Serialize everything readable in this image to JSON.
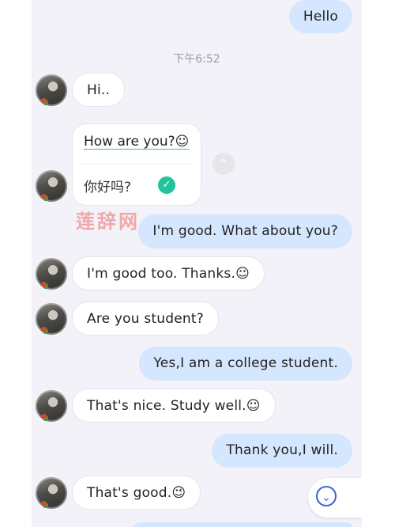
{
  "timestamp": "下午6:52",
  "messages": [
    {
      "side": "out",
      "text": "Hello"
    },
    {
      "side": "in",
      "text": "Hi.."
    },
    {
      "side": "in",
      "card": true,
      "text": "How are you?",
      "emoji": "☺",
      "translation": "你好吗?"
    },
    {
      "side": "out",
      "text": "I'm good. What about you?"
    },
    {
      "side": "in",
      "text": "I'm good too. Thanks.☺"
    },
    {
      "side": "in",
      "text": "Are you student?"
    },
    {
      "side": "out",
      "text": "Yes,I am a college student."
    },
    {
      "side": "in",
      "text": "That's nice. Study well.☺"
    },
    {
      "side": "out",
      "text": "Thank you,I will."
    },
    {
      "side": "in",
      "text": "That's good.😉"
    }
  ],
  "watermark": "莲辞网",
  "icons": {
    "check": "check-circle-icon",
    "collapse": "chevron-up-icon",
    "scroll": "chevron-down-icon"
  },
  "colors": {
    "incoming_bubble": "#ffffff",
    "outgoing_bubble": "#d5e7ff",
    "background": "#f3f2f8",
    "accent": "#3c62d8",
    "check": "#22c39a"
  }
}
